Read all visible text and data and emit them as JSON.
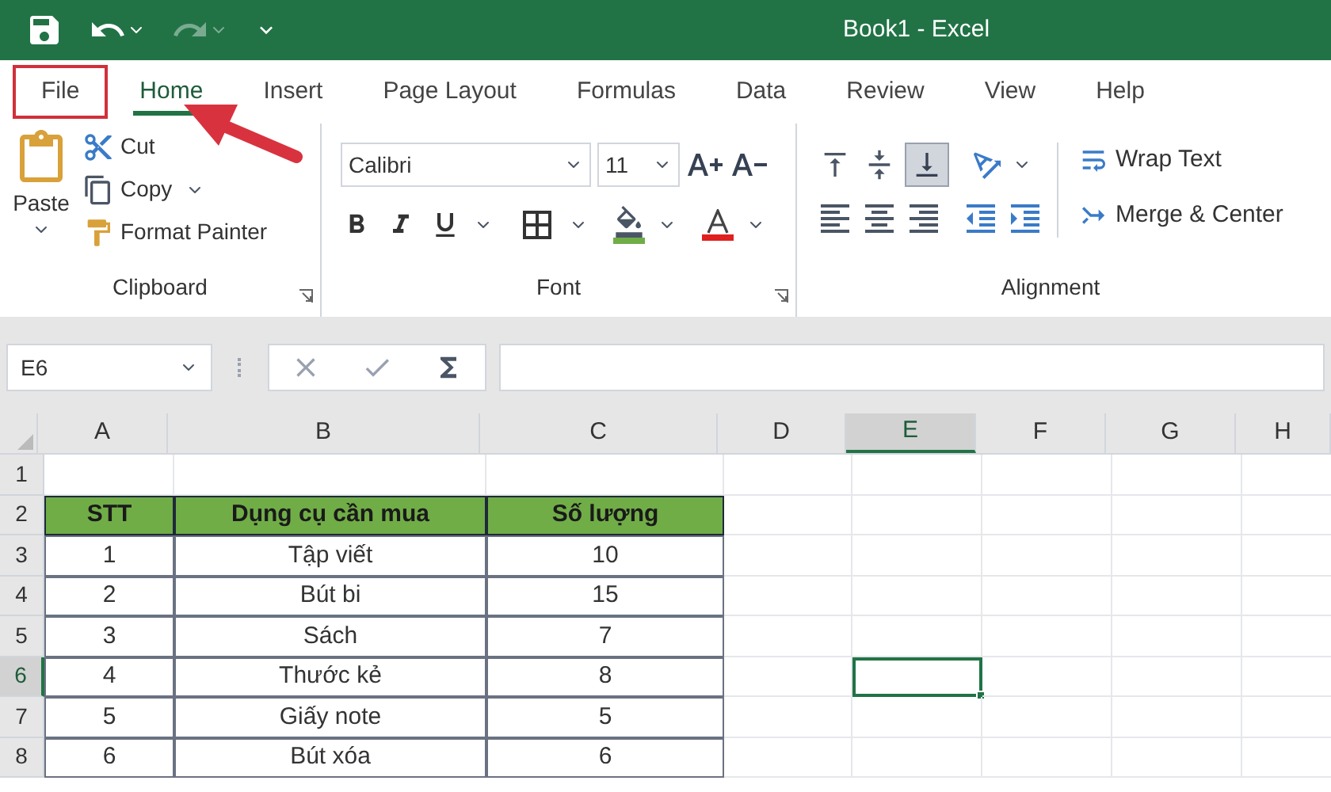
{
  "title_bar": {
    "title": "Book1  -  Excel"
  },
  "tabs": [
    {
      "label": "File",
      "selected": false,
      "highlighted": true
    },
    {
      "label": "Home",
      "selected": true,
      "highlighted": false
    },
    {
      "label": "Insert",
      "selected": false,
      "highlighted": false
    },
    {
      "label": "Page Layout",
      "selected": false,
      "highlighted": false
    },
    {
      "label": "Formulas",
      "selected": false,
      "highlighted": false
    },
    {
      "label": "Data",
      "selected": false,
      "highlighted": false
    },
    {
      "label": "Review",
      "selected": false,
      "highlighted": false
    },
    {
      "label": "View",
      "selected": false,
      "highlighted": false
    },
    {
      "label": "Help",
      "selected": false,
      "highlighted": false
    }
  ],
  "pointer_arrow": {
    "shown": true
  },
  "clipboard": {
    "paste": "Paste",
    "cut": "Cut",
    "copy": "Copy",
    "format_painter": "Format Painter",
    "label": "Clipboard"
  },
  "font": {
    "font_name": "Calibri",
    "font_size": "11",
    "label": "Font"
  },
  "alignment": {
    "bottom_align_selected": true,
    "wrap_text": "Wrap Text",
    "merge_center": "Merge & Center",
    "label": "Alignment"
  },
  "name_box": "E6",
  "sheet": {
    "columns": [
      {
        "label": "A",
        "selected": false
      },
      {
        "label": "B",
        "selected": false
      },
      {
        "label": "C",
        "selected": false
      },
      {
        "label": "D",
        "selected": false
      },
      {
        "label": "E",
        "selected": true
      },
      {
        "label": "F",
        "selected": false
      },
      {
        "label": "G",
        "selected": false
      },
      {
        "label": "H",
        "selected": false
      }
    ],
    "rows": [
      {
        "label": "1",
        "selected": false,
        "kind": "plain",
        "cells": []
      },
      {
        "label": "2",
        "selected": false,
        "kind": "header",
        "cells": [
          "STT",
          "Dụng cụ cần mua",
          "Số lượng"
        ]
      },
      {
        "label": "3",
        "selected": false,
        "kind": "plain",
        "cells": [
          "1",
          "Tập viết",
          "10"
        ]
      },
      {
        "label": "4",
        "selected": false,
        "kind": "plain",
        "cells": [
          "2",
          "Bút bi",
          "15"
        ]
      },
      {
        "label": "5",
        "selected": false,
        "kind": "plain",
        "cells": [
          "3",
          "Sách",
          "7"
        ]
      },
      {
        "label": "6",
        "selected": true,
        "kind": "plain",
        "cells": [
          "4",
          "Thước kẻ",
          "8"
        ]
      },
      {
        "label": "7",
        "selected": false,
        "kind": "plain",
        "cells": [
          "5",
          "Giấy note",
          "5"
        ]
      },
      {
        "label": "8",
        "selected": false,
        "kind": "plain",
        "cells": [
          "6",
          "Bút xóa",
          "6"
        ]
      }
    ]
  }
}
